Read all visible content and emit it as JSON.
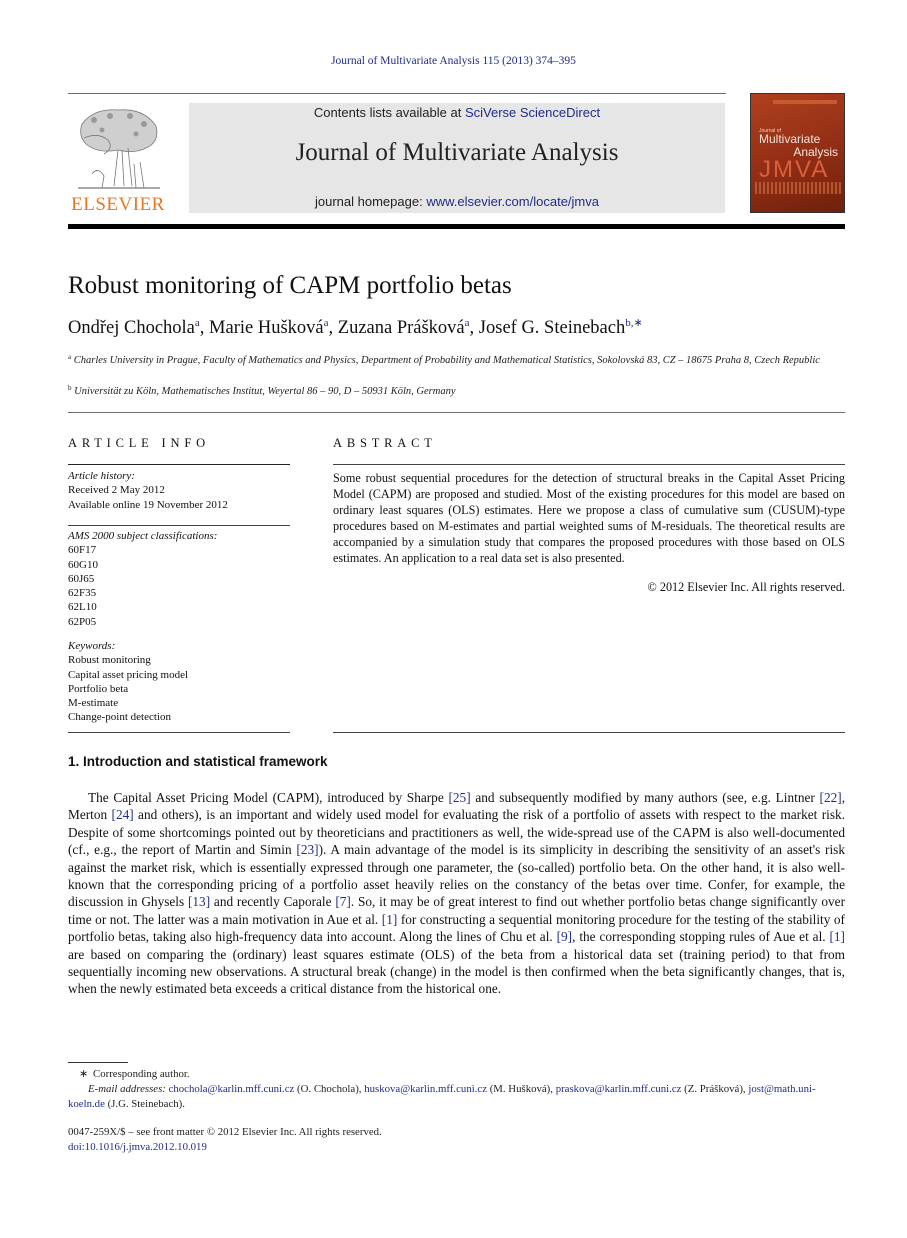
{
  "running_head": "Journal of Multivariate Analysis 115 (2013) 374–395",
  "publisher": {
    "logo_word": "ELSEVIER",
    "contents_prefix": "Contents lists available at ",
    "contents_link": "SciVerse ScienceDirect",
    "journal_title": "Journal of Multivariate Analysis",
    "homepage_prefix": "journal homepage: ",
    "homepage_link": "www.elsevier.com/locate/jmva",
    "cover": {
      "small": "Journal of",
      "line1": "Multivariate",
      "line2": "Analysis",
      "abbrev": "JMVA"
    }
  },
  "colors": {
    "link": "#1f2d8a",
    "elsevier_orange": "#e87722",
    "banner_bg": "#e6e6e6"
  },
  "article": {
    "title": "Robust monitoring of CAPM portfolio betas",
    "authors": [
      {
        "name": "Ondřej Chochola",
        "sup": "a",
        "sep": ", "
      },
      {
        "name": "Marie Hušková",
        "sup": "a",
        "sep": ", "
      },
      {
        "name": "Zuzana Prášková",
        "sup": "a",
        "sep": ", "
      },
      {
        "name": "Josef G. Steinebach",
        "sup": "b,∗",
        "sep": ""
      }
    ],
    "affiliations": [
      {
        "sup": "a",
        "text": "Charles University in Prague, Faculty of Mathematics and Physics, Department of Probability and Mathematical Statistics, Sokolovská 83, CZ – 18675 Praha 8, Czech Republic"
      },
      {
        "sup": "b",
        "text": "Universität zu Köln, Mathematisches Institut, Weyertal 86 – 90, D – 50931 Köln, Germany"
      }
    ]
  },
  "article_info": {
    "heading": "ARTICLE INFO",
    "history_label": "Article history:",
    "received": "Received 2 May 2012",
    "available": "Available online 19 November 2012",
    "ams_label": "AMS 2000 subject classifications:",
    "ams_codes": [
      "60F17",
      "60G10",
      "60J65",
      "62F35",
      "62L10",
      "62P05"
    ],
    "keywords_label": "Keywords:",
    "keywords": [
      "Robust monitoring",
      "Capital asset pricing model",
      "Portfolio beta",
      "M-estimate",
      "Change-point detection"
    ]
  },
  "abstract": {
    "heading": "ABSTRACT",
    "text": "Some robust sequential procedures for the detection of structural breaks in the Capital Asset Pricing Model (CAPM) are proposed and studied. Most of the existing procedures for this model are based on ordinary least squares (OLS) estimates. Here we propose a class of cumulative sum (CUSUM)-type procedures based on M-estimates and partial weighted sums of M-residuals. The theoretical results are accompanied by a simulation study that compares the proposed procedures with those based on OLS estimates. An application to a real data set is also presented.",
    "copyright": "© 2012 Elsevier Inc. All rights reserved."
  },
  "section1": {
    "heading": "1.  Introduction and statistical framework",
    "segments": [
      {
        "t": "The Capital Asset Pricing Model (CAPM), introduced by Sharpe "
      },
      {
        "t": "[25]",
        "link": true
      },
      {
        "t": " and subsequently modified by many authors (see, e.g. Lintner "
      },
      {
        "t": "[22]",
        "link": true
      },
      {
        "t": ", Merton "
      },
      {
        "t": "[24]",
        "link": true
      },
      {
        "t": " and others), is an important and widely used model for evaluating the risk of a portfolio of assets with respect to the market risk. Despite of some shortcomings pointed out by theoreticians and practitioners as well, the wide-spread use of the CAPM is also well-documented (cf., e.g., the report of Martin and Simin "
      },
      {
        "t": "[23]",
        "link": true
      },
      {
        "t": "). A main advantage of the model is its simplicity in describing the sensitivity of an asset's risk against the market risk, which is essentially expressed through one parameter, the (so-called) portfolio beta. On the other hand, it is also well-known that the corresponding pricing of a portfolio asset heavily relies on the constancy of the betas over time. Confer, for example, the discussion in Ghysels "
      },
      {
        "t": "[13]",
        "link": true
      },
      {
        "t": " and recently Caporale "
      },
      {
        "t": "[7]",
        "link": true
      },
      {
        "t": ". So, it may be of great interest to find out whether portfolio betas change significantly over time or not. The latter was a main motivation in Aue et al. "
      },
      {
        "t": "[1]",
        "link": true
      },
      {
        "t": " for constructing a sequential monitoring procedure for the testing of the stability of portfolio betas, taking also high-frequency data into account. Along the lines of Chu et al. "
      },
      {
        "t": "[9]",
        "link": true
      },
      {
        "t": ", the corresponding stopping rules of Aue et al. "
      },
      {
        "t": "[1]",
        "link": true
      },
      {
        "t": " are based on comparing the (ordinary) least squares estimate (OLS) of the beta from a historical data set (training period) to that from sequentially incoming new observations. A structural break (change) in the model is then confirmed when the beta significantly changes, that is, when the newly estimated beta exceeds a critical distance from the historical one."
      }
    ]
  },
  "footnotes": {
    "asterisk": "∗",
    "corresponding": "Corresponding author.",
    "email_label": "E-mail addresses:",
    "emails": [
      {
        "addr": "chochola@karlin.mff.cuni.cz",
        "who": " (O. Chochola), "
      },
      {
        "addr": "huskova@karlin.mff.cuni.cz",
        "who": " (M. Hušková), "
      },
      {
        "addr": "praskova@karlin.mff.cuni.cz",
        "who": " (Z. Prášková), "
      },
      {
        "addr": "jost@math.uni-koeln.de",
        "who": " (J.G. Steinebach)."
      }
    ],
    "issn": "0047-259X/$ – see front matter © 2012 Elsevier Inc. All rights reserved.",
    "doi": "doi:10.1016/j.jmva.2012.10.019"
  }
}
